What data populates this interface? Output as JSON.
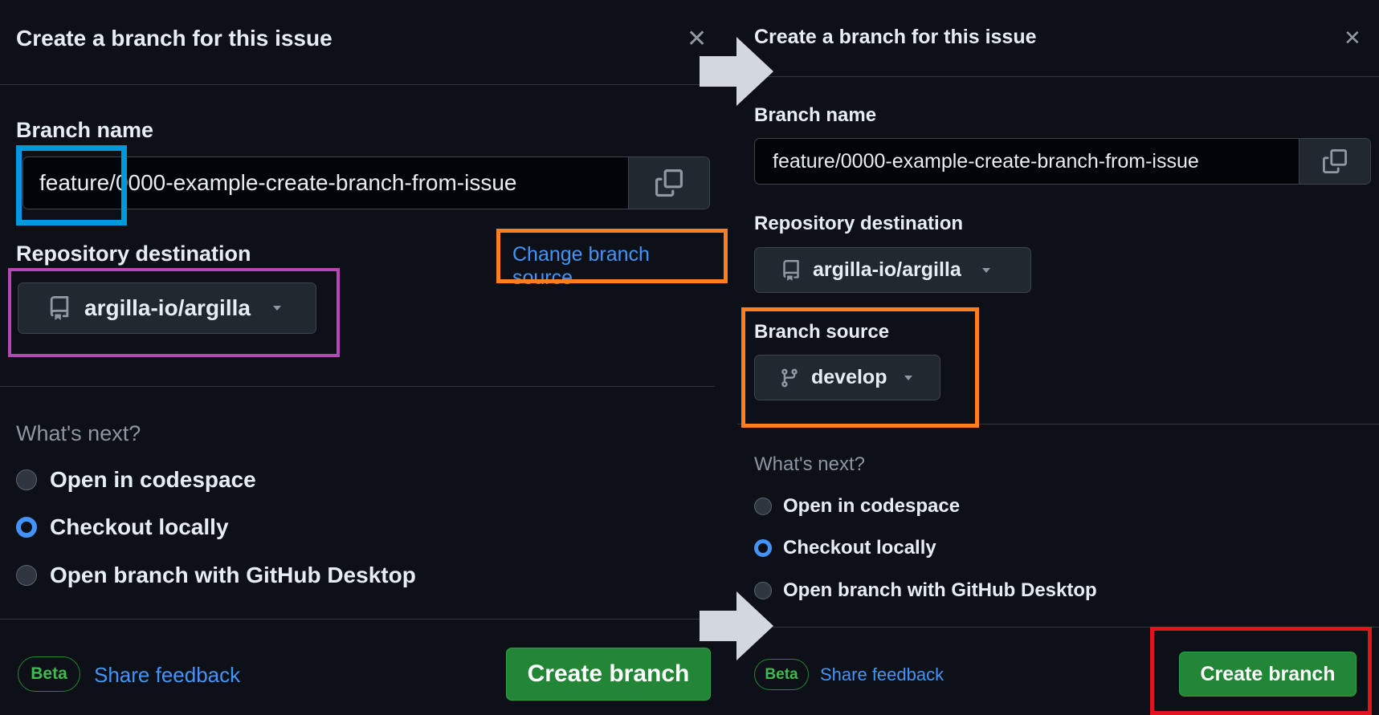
{
  "before": {
    "title": "Create a branch for this issue",
    "branch_label": "Branch name",
    "branch_value": "feature/0000-example-create-branch-from-issue",
    "repo_label": "Repository destination",
    "change_source_link": "Change branch source",
    "repo_value": "argilla-io/argilla",
    "whats_next": "What's next?",
    "options": [
      "Open in codespace",
      "Checkout locally",
      "Open branch with GitHub Desktop"
    ],
    "selected_option": "Checkout locally",
    "beta": "Beta",
    "feedback": "Share feedback",
    "create": "Create branch"
  },
  "after": {
    "title": "Create a branch for this issue",
    "branch_label": "Branch name",
    "branch_value": "feature/0000-example-create-branch-from-issue",
    "repo_label": "Repository destination",
    "repo_value": "argilla-io/argilla",
    "source_label": "Branch source",
    "source_value": "develop",
    "whats_next": "What's next?",
    "options": [
      "Open in codespace",
      "Checkout locally",
      "Open branch with GitHub Desktop"
    ],
    "selected_option": "Checkout locally",
    "beta": "Beta",
    "feedback": "Share feedback",
    "create": "Create branch"
  },
  "colors": {
    "highlight_blue": "#0099dd",
    "highlight_orange": "#ff7f1e",
    "highlight_purple": "#b548b5",
    "highlight_red": "#e0141e",
    "arrow": "#d3d8df",
    "primary_green": "#238636",
    "link": "#4493f8"
  },
  "icons": [
    "close-icon",
    "copy-icon",
    "repo-icon",
    "git-branch-icon",
    "caret-down-icon",
    "arrow-right-icon"
  ]
}
